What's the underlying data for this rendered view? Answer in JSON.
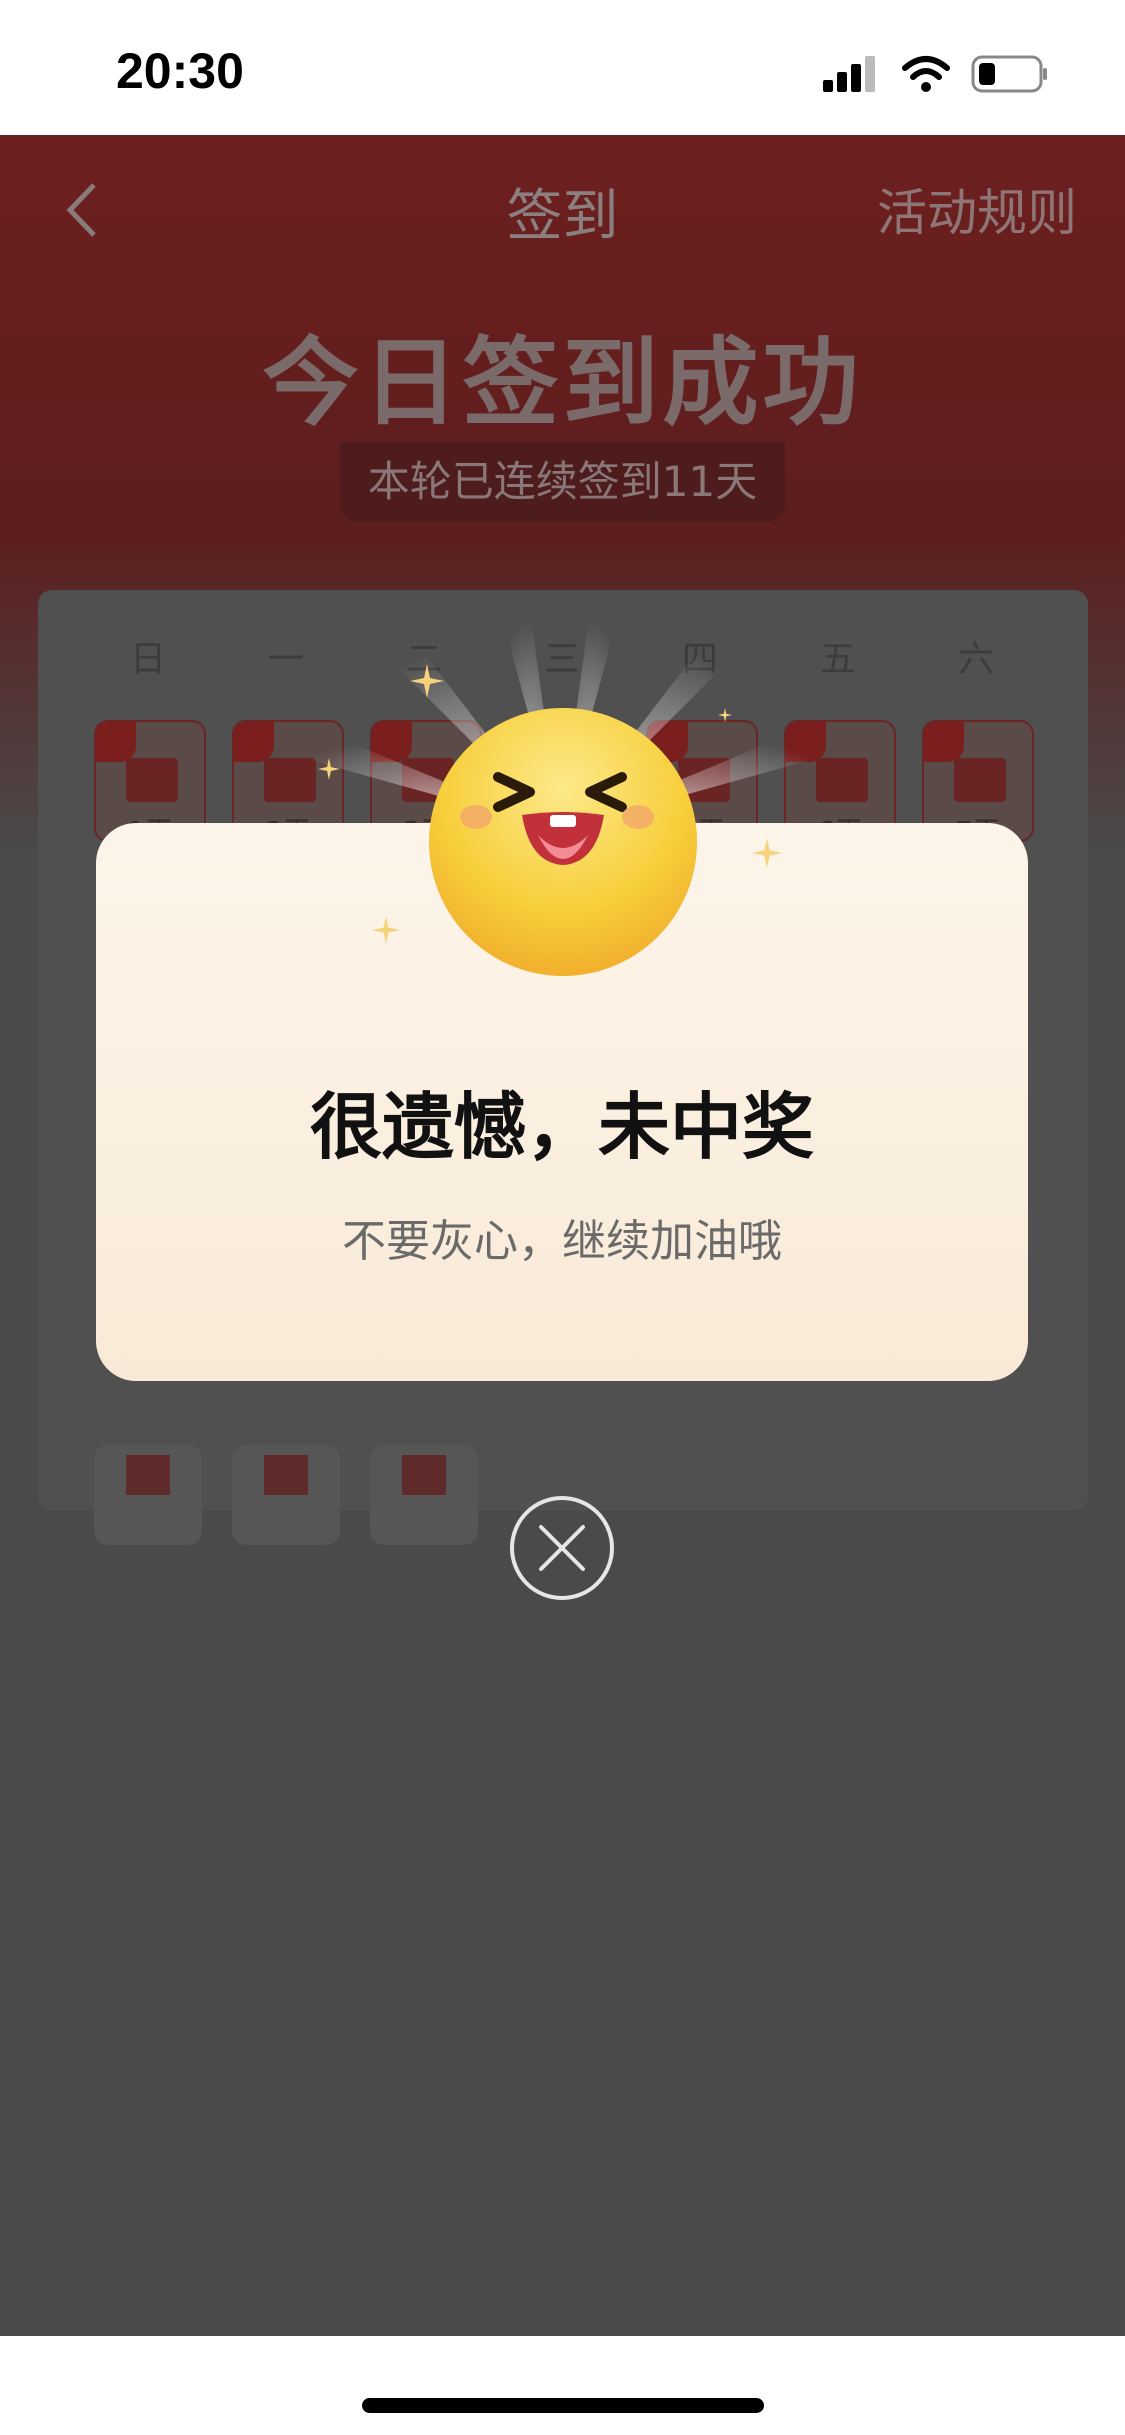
{
  "status_bar": {
    "time": "20:30"
  },
  "nav": {
    "title": "签到",
    "rules_label": "活动规则"
  },
  "hero": {
    "title": "今日签到成功",
    "streak_text": "本轮已连续签到11天"
  },
  "calendar": {
    "weekdays": [
      "日",
      "一",
      "二",
      "三",
      "四",
      "五",
      "六"
    ],
    "days": [
      {
        "label": "1天"
      },
      {
        "label": "2天"
      },
      {
        "label": "3天"
      },
      {
        "label": "4天"
      },
      {
        "label": "5天"
      },
      {
        "label": "6天"
      },
      {
        "label": "7天"
      }
    ]
  },
  "modal": {
    "title": "很遗憾，未中奖",
    "subtitle": "不要灰心，继续加油哦"
  },
  "icons": {
    "back": "chevron-left-icon",
    "close": "close-circle-icon",
    "emoji": "laughing-emoji-icon"
  },
  "colors": {
    "hero_red": "#6e1f1f",
    "modal_bg": "#fdf5ea",
    "emoji_yellow": "#f7cf3c",
    "overlay": "#4a4a4a"
  }
}
